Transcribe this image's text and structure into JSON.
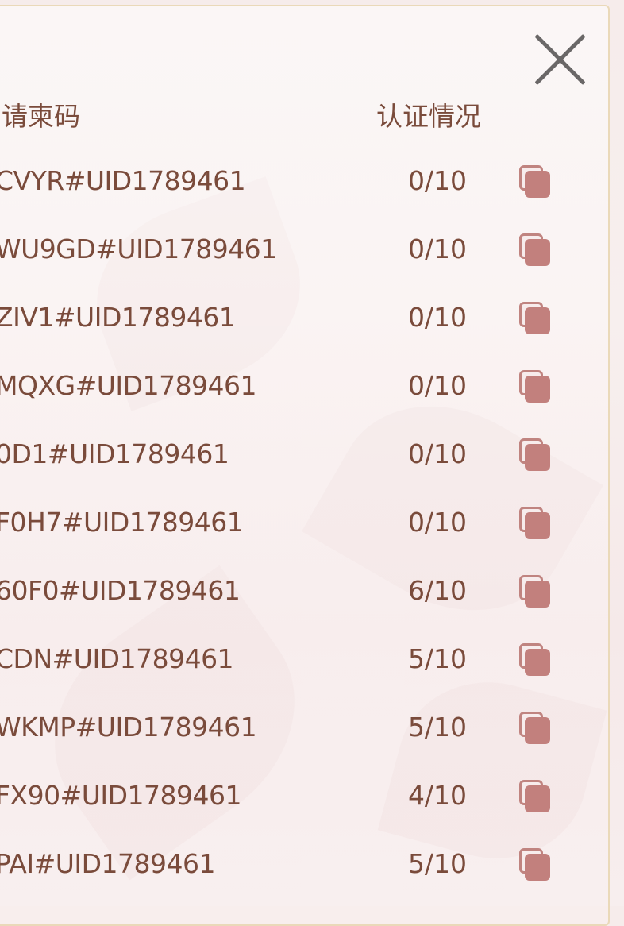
{
  "close_icon": "close-icon",
  "header": {
    "code_label": "请柬码",
    "status_label": "认证情况"
  },
  "rows": [
    {
      "code": "CVYR#UID1789461",
      "count": "0/10"
    },
    {
      "code": "WU9GD#UID1789461",
      "count": "0/10"
    },
    {
      "code": "ZIV1#UID1789461",
      "count": "0/10"
    },
    {
      "code": "MQXG#UID1789461",
      "count": "0/10"
    },
    {
      "code": "0D1#UID1789461",
      "count": "0/10"
    },
    {
      "code": "F0H7#UID1789461",
      "count": "0/10"
    },
    {
      "code": "60F0#UID1789461",
      "count": "6/10"
    },
    {
      "code": "CDN#UID1789461",
      "count": "5/10"
    },
    {
      "code": "WKMP#UID1789461",
      "count": "5/10"
    },
    {
      "code": "FX90#UID1789461",
      "count": "4/10"
    },
    {
      "code": "PAI#UID1789461",
      "count": "5/10"
    }
  ],
  "colors": {
    "text": "#7a4b3b",
    "copy_icon": "#c2807d",
    "border": "#ead9b9",
    "close_icon": "#6a6767"
  }
}
